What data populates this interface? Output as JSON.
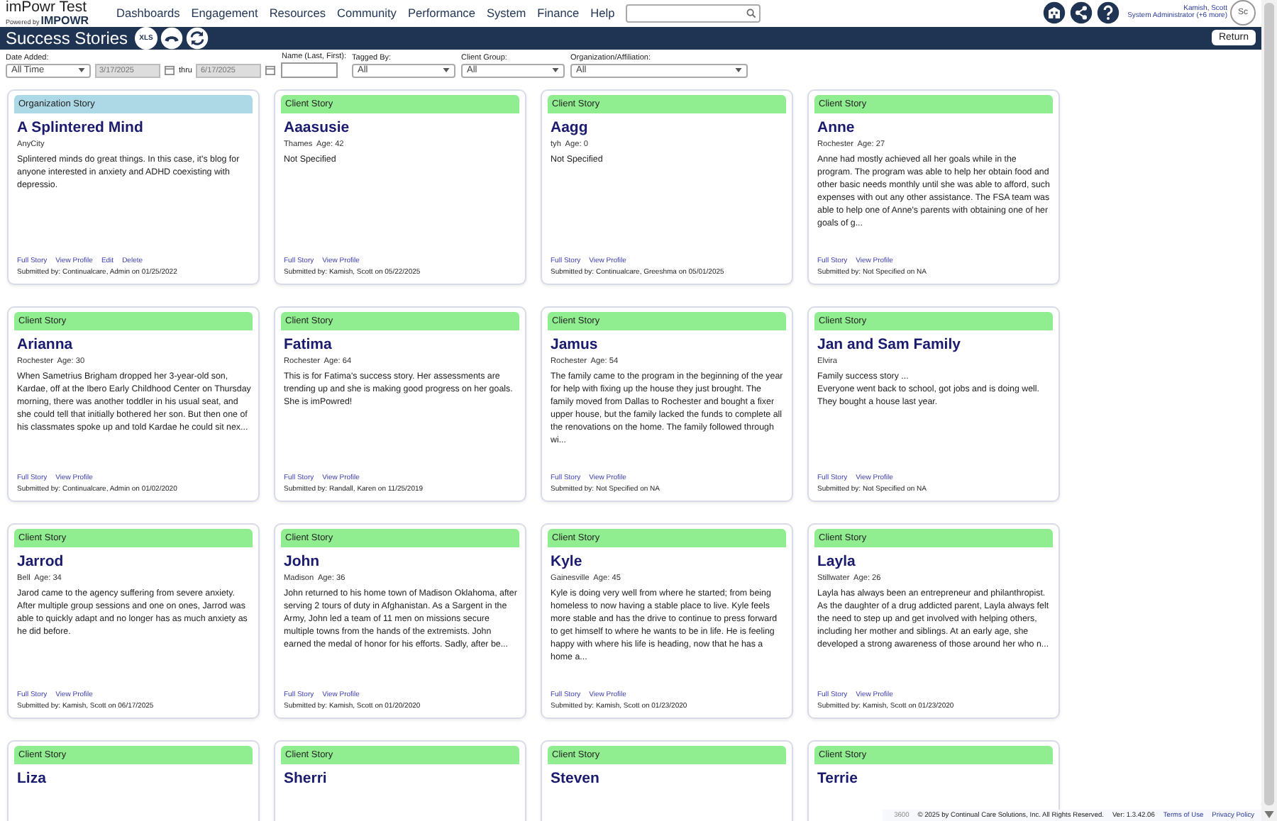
{
  "header": {
    "logo_title": "imPowr Test",
    "logo_powered_by": "Powered by",
    "logo_brand": "IMPOWR",
    "nav": [
      "Dashboards",
      "Engagement",
      "Resources",
      "Community",
      "Performance",
      "System",
      "Finance",
      "Help"
    ],
    "user": {
      "name": "Kamish, Scott",
      "role": "System Administrator (+6 more)",
      "avatar_text": "Sc"
    }
  },
  "toolbar": {
    "title": "Success Stories",
    "xls_label": "XLS",
    "return_label": "Return"
  },
  "filters": {
    "date_added": {
      "label": "Date Added:",
      "value": "All Time",
      "from": {
        "value": "3/17/2025",
        "disabled": true
      },
      "thru_label": "thru",
      "to": {
        "value": "6/17/2025",
        "disabled": true
      }
    },
    "name": {
      "label": "Name (Last, First):"
    },
    "selects": [
      {
        "label": "Tagged By:",
        "value": "All"
      },
      {
        "label": "Client Group:",
        "value": "All"
      },
      {
        "label": "Organization/Affiliation:",
        "value": "All"
      }
    ]
  },
  "cards": [
    {
      "kind": "organization",
      "label": "Organization Story",
      "name": "A Splintered Mind",
      "meta": "AnyCity",
      "summary": "Splintered minds do great things. In this case, it's blog for anyone interested in anxiety and ADHD coexisting with depressio.",
      "links": [
        "Full Story",
        "View Profile",
        "Edit",
        "Delete"
      ],
      "submitted": "Submitted by: Continualcare, Admin on 01/25/2022"
    },
    {
      "kind": "client",
      "label": "Client Story",
      "name": "Aaasusie",
      "meta": "Thames  Age: 42",
      "summary": "Not Specified",
      "links": [
        "Full Story",
        "View Profile"
      ],
      "submitted": "Submitted by: Kamish, Scott on 05/22/2025"
    },
    {
      "kind": "client",
      "label": "Client Story",
      "name": "Aagg",
      "meta": "tyh  Age: 0",
      "summary": "Not Specified",
      "links": [
        "Full Story",
        "View Profile"
      ],
      "submitted": "Submitted by: Continualcare, Greeshma on 05/01/2025"
    },
    {
      "kind": "client",
      "label": "Client Story",
      "name": "Anne",
      "meta": "Rochester  Age: 27",
      "summary": "Anne had mostly achieved all her goals while in the program. The program was able to help her obtain food and other basic needs monthly until she was able to afford, such expenses with out any other assistance. The FSA team was able to help one of Anne's parents with obtaining one of her goals of g...",
      "links": [
        "Full Story",
        "View Profile"
      ],
      "submitted": "Submitted by: Not Specified on NA"
    },
    {
      "kind": "client",
      "label": "Client Story",
      "name": "Arianna",
      "meta": "Rochester  Age: 30",
      "summary": "When Sametrius Brigham dropped her 3-year-old son, Kardae, off at the Ibero Early Childhood Center on Thursday morning, there was another toddler in his usual seat, and she could tell that initially bothered her son. But then one of his classmates spoke up and told Kardae he could sit nex...",
      "links": [
        "Full Story",
        "View Profile"
      ],
      "submitted": "Submitted by: Continualcare, Admin on 01/02/2020"
    },
    {
      "kind": "client",
      "label": "Client Story",
      "name": "Fatima",
      "meta": "Rochester  Age: 64",
      "summary": "This is for Fatima's success story.  Her assessments are trending up and she is making good progress on her goals.  She is imPowred!",
      "links": [
        "Full Story",
        "View Profile"
      ],
      "submitted": "Submitted by: Randall, Karen on 11/25/2019"
    },
    {
      "kind": "client",
      "label": "Client Story",
      "name": "Jamus",
      "meta": "Rochester  Age: 54",
      "summary": "The family came to the program in the beginning of the year for help with fixing up the house they just brought. The family moved from Dallas to Rochester and bought a fixer upper house, but the family lacked the funds to complete all the renovations on the home. The family followed through wi...",
      "links": [
        "Full Story",
        "View Profile"
      ],
      "submitted": "Submitted by: Not Specified on NA"
    },
    {
      "kind": "client",
      "label": "Client Story",
      "name": "Jan and Sam Family",
      "meta": "Elvira",
      "summary": "Family success story ...\nEveryone went back to school, got jobs and is doing well. They bought a house last year.",
      "links": [
        "Full Story",
        "View Profile"
      ],
      "submitted": "Submitted by: Not Specified on NA"
    },
    {
      "kind": "client",
      "label": "Client Story",
      "name": "Jarrod",
      "meta": "Bell  Age: 34",
      "summary": "Jarod came to the agency suffering from severe anxiety. After multiple group sessions and one on ones, Jarrod was able to quickly adapt and no longer has as much anxiety as he did before.",
      "links": [
        "Full Story",
        "View Profile"
      ],
      "submitted": "Submitted by: Kamish, Scott on 06/17/2025"
    },
    {
      "kind": "client",
      "label": "Client Story",
      "name": "John",
      "meta": "Madison  Age: 36",
      "summary": "John returned to his home town of Madison Oklahoma, after serving 2 tours of duty in Afghanistan.  As a Sargent in the Army, John led a team of 11 men on missions secure multiple towns from the hands of the extremists.  John earned the medal of honor for his efforts.  Sadly, after be...",
      "links": [
        "Full Story",
        "View Profile"
      ],
      "submitted": "Submitted by: Kamish, Scott on 01/20/2020"
    },
    {
      "kind": "client",
      "label": "Client Story",
      "name": "Kyle",
      "meta": "Gainesville  Age: 45",
      "summary": "Kyle is doing very well from where he started; from being homeless to now having a stable place to live. Kyle feels more stable and has the drive to continue to press forward to get himself to where he wants to be in life. He is feeling happy with where his life is heading, now that he has a home a...",
      "links": [
        "Full Story",
        "View Profile"
      ],
      "submitted": "Submitted by: Kamish, Scott on 01/23/2020"
    },
    {
      "kind": "client",
      "label": "Client Story",
      "name": "Layla",
      "meta": "Stillwater  Age: 26",
      "summary": "Layla has always been an entrepreneur and philanthropist.  As the daughter of a drug addicted parent, Layla always felt the need to step up and get involved with helping others, including her mother and siblings.  At an early age, she developed a strong awareness of those around her who n...",
      "links": [
        "Full Story",
        "View Profile"
      ],
      "submitted": "Submitted by: Kamish, Scott on 01/23/2020"
    },
    {
      "kind": "client",
      "label": "Client Story",
      "name": "Liza"
    },
    {
      "kind": "client",
      "label": "Client Story",
      "name": "Sherri"
    },
    {
      "kind": "client",
      "label": "Client Story",
      "name": "Steven"
    },
    {
      "kind": "client",
      "label": "Client Story",
      "name": "Terrie"
    }
  ],
  "footer": {
    "code": "3600",
    "copyright": "© 2025 by Continual Care Solutions, Inc. All Rights Reserved.",
    "version": "Ver: 1.3.42.06",
    "links": [
      "Terms of Use",
      "Privacy Policy"
    ]
  }
}
